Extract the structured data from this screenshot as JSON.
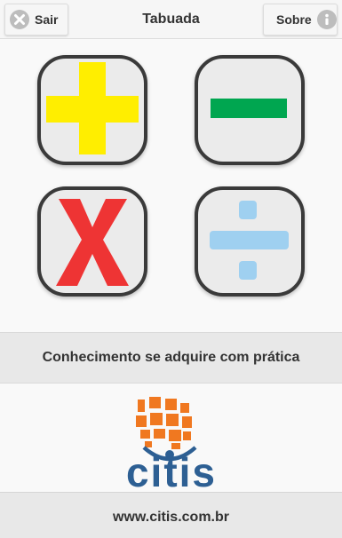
{
  "header": {
    "title": "Tabuada",
    "exit_label": "Sair",
    "about_label": "Sobre",
    "exit_icon": "close-circle-icon",
    "about_icon": "info-circle-icon"
  },
  "operations": [
    {
      "name": "addition",
      "icon": "plus-icon",
      "color": "#ffee00"
    },
    {
      "name": "subtraction",
      "icon": "minus-icon",
      "color": "#00a650"
    },
    {
      "name": "multiplication",
      "icon": "multiply-icon",
      "color": "#ee3434"
    },
    {
      "name": "division",
      "icon": "divide-icon",
      "color": "#9fd0f0"
    }
  ],
  "motto": "Conhecimento se adquire com prática",
  "logo": {
    "text": "citis",
    "brand_blue": "#2d5f93",
    "brand_orange": "#f07820"
  },
  "footer": {
    "url": "www.citis.com.br"
  }
}
